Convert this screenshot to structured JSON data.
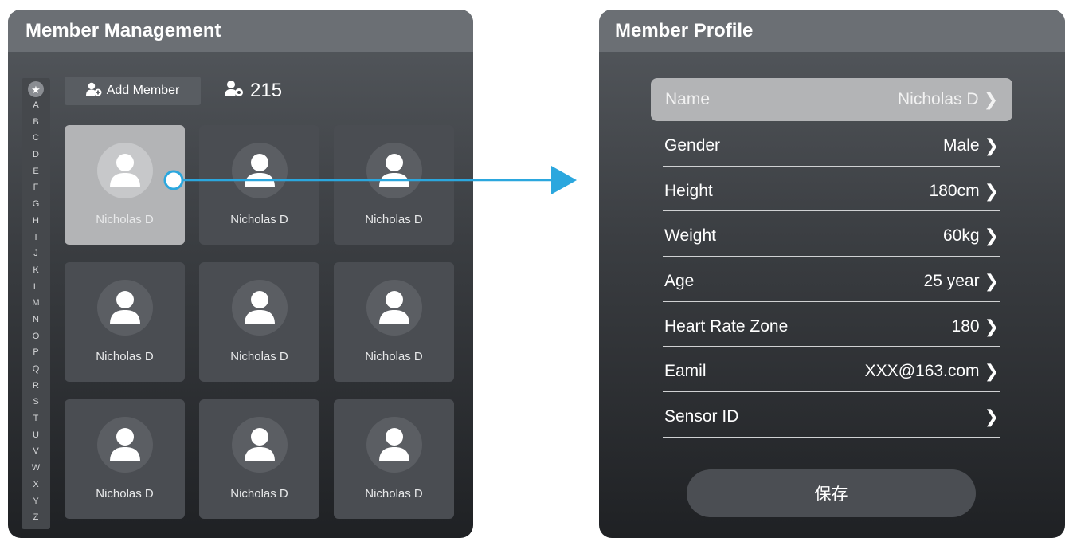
{
  "left_panel": {
    "title": "Member Management",
    "alphabet": [
      "A",
      "B",
      "C",
      "D",
      "E",
      "F",
      "G",
      "H",
      "I",
      "J",
      "K",
      "L",
      "M",
      "N",
      "O",
      "P",
      "Q",
      "R",
      "S",
      "T",
      "U",
      "V",
      "W",
      "X",
      "Y",
      "Z"
    ],
    "add_member_label": "Add Member",
    "member_count": "215",
    "members": [
      {
        "name": "Nicholas D",
        "selected": true
      },
      {
        "name": "Nicholas D",
        "selected": false
      },
      {
        "name": "Nicholas D",
        "selected": false
      },
      {
        "name": "Nicholas D",
        "selected": false
      },
      {
        "name": "Nicholas D",
        "selected": false
      },
      {
        "name": "Nicholas D",
        "selected": false
      },
      {
        "name": "Nicholas D",
        "selected": false
      },
      {
        "name": "Nicholas D",
        "selected": false
      },
      {
        "name": "Nicholas D",
        "selected": false
      }
    ]
  },
  "right_panel": {
    "title": "Member Profile",
    "fields": [
      {
        "label": "Name",
        "value": "Nicholas D"
      },
      {
        "label": "Gender",
        "value": "Male"
      },
      {
        "label": "Height",
        "value": "180cm"
      },
      {
        "label": "Weight",
        "value": "60kg"
      },
      {
        "label": "Age",
        "value": "25 year"
      },
      {
        "label": "Heart Rate Zone",
        "value": "180"
      },
      {
        "label": "Eamil",
        "value": "XXX@163.com"
      },
      {
        "label": "Sensor ID",
        "value": ""
      }
    ],
    "save_label": "保存"
  },
  "colors": {
    "accent": "#2ba7de",
    "selected_card": "#b3b4b6",
    "header_bg": "#6b6f74"
  }
}
